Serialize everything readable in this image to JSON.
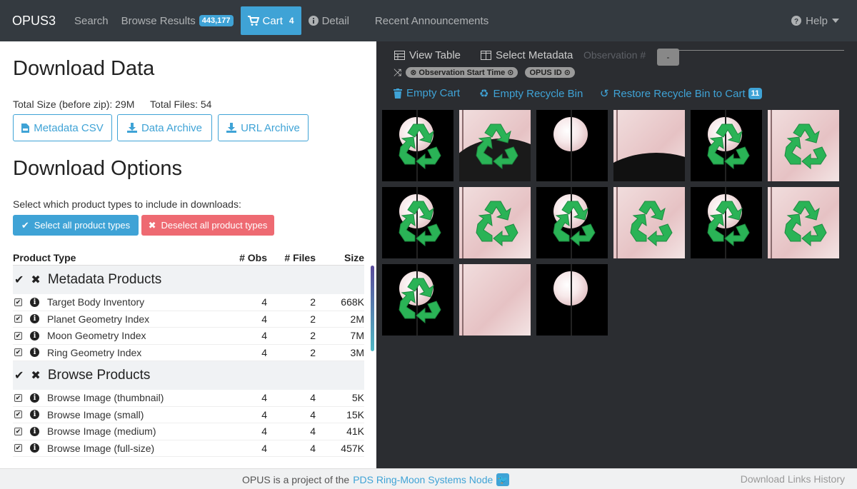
{
  "nav": {
    "brand": "OPUS3",
    "search": "Search",
    "browse": "Browse Results",
    "browse_count": "443,177",
    "cart": "Cart",
    "cart_count": "4",
    "detail": "Detail",
    "announcements": "Recent Announcements",
    "help": "Help"
  },
  "left": {
    "title": "Download Data",
    "total_size_label": "Total Size (before zip): 29M",
    "total_files_label": "Total Files: 54",
    "buttons": {
      "metadata_csv": "Metadata CSV",
      "data_archive": "Data Archive",
      "url_archive": "URL Archive"
    },
    "options_title": "Download Options",
    "prompt": "Select which product types to include in downloads:",
    "select_all": "Select all product types",
    "deselect_all": "Deselect all product types",
    "columns": {
      "type": "Product Type",
      "obs": "# Obs",
      "files": "# Files",
      "size": "Size"
    },
    "groups": [
      {
        "name": "Metadata Products",
        "rows": [
          {
            "name": "Target Body Inventory",
            "obs": "4",
            "files": "2",
            "size": "668K"
          },
          {
            "name": "Planet Geometry Index",
            "obs": "4",
            "files": "2",
            "size": "2M"
          },
          {
            "name": "Moon Geometry Index",
            "obs": "4",
            "files": "2",
            "size": "7M"
          },
          {
            "name": "Ring Geometry Index",
            "obs": "4",
            "files": "2",
            "size": "3M"
          }
        ]
      },
      {
        "name": "Browse Products",
        "rows": [
          {
            "name": "Browse Image (thumbnail)",
            "obs": "4",
            "files": "4",
            "size": "5K"
          },
          {
            "name": "Browse Image (small)",
            "obs": "4",
            "files": "4",
            "size": "15K"
          },
          {
            "name": "Browse Image (medium)",
            "obs": "4",
            "files": "4",
            "size": "41K"
          },
          {
            "name": "Browse Image (full-size)",
            "obs": "4",
            "files": "4",
            "size": "457K"
          }
        ]
      }
    ]
  },
  "right": {
    "view_table": "View Table",
    "select_metadata": "Select Metadata",
    "observation_label": "Observation #",
    "slider_value": "-",
    "sort_pills": [
      "Observation Start Time",
      "OPUS ID"
    ],
    "empty_cart": "Empty Cart",
    "empty_recycle": "Empty Recycle Bin",
    "restore_recycle": "Restore Recycle Bin to Cart",
    "restore_count": "11",
    "thumbnails": [
      {
        "style": "dark",
        "recycled": true
      },
      {
        "style": "pink",
        "recycled": true
      },
      {
        "style": "dark",
        "recycled": false
      },
      {
        "style": "pink",
        "recycled": false
      },
      {
        "style": "dark",
        "recycled": true
      },
      {
        "style": "pink",
        "recycled": true
      },
      {
        "style": "dark",
        "recycled": true
      },
      {
        "style": "pink",
        "recycled": true
      },
      {
        "style": "dark",
        "recycled": true
      },
      {
        "style": "pink",
        "recycled": true
      },
      {
        "style": "dark",
        "recycled": true
      },
      {
        "style": "pink",
        "recycled": true
      },
      {
        "style": "dark",
        "recycled": true
      },
      {
        "style": "pink",
        "recycled": false
      },
      {
        "style": "dark",
        "recycled": false
      }
    ]
  },
  "footer": {
    "prefix": "OPUS is a project of the",
    "link": "PDS Ring-Moon Systems Node",
    "history": "Download Links History"
  },
  "colors": {
    "accent": "#3fa3d6",
    "danger": "#ee6a72",
    "navbar": "#343a40",
    "recycle": "#2ab356"
  }
}
